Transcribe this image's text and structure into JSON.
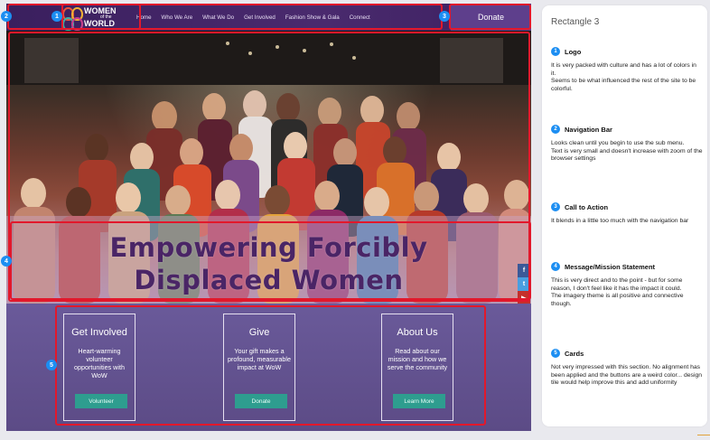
{
  "website": {
    "logo": {
      "line1": "WOMEN",
      "line2": "of the",
      "line3": "WORLD"
    },
    "nav_items": [
      "Home",
      "Who We Are",
      "What We Do",
      "Get Involved",
      "Fashion Show & Gala",
      "Connect"
    ],
    "donate_label": "Donate",
    "hero_headline_line1": "Empowering Forcibly",
    "hero_headline_line2": "Displaced Women",
    "social_icons": [
      "facebook-icon",
      "twitter-icon",
      "youtube-icon",
      "instagram-icon",
      "other-social-icon"
    ],
    "cards": [
      {
        "title": "Get Involved",
        "text": "Heart-warming volunteer opportunities with WoW",
        "button": "Volunteer"
      },
      {
        "title": "Give",
        "text": "Your gift makes a profound, measurable impact at WoW",
        "button": "Donate"
      },
      {
        "title": "About Us",
        "text": "Read about our mission and how we serve the community",
        "button": "Learn More"
      }
    ]
  },
  "annotations": {
    "badges": [
      "1",
      "2",
      "3",
      "4",
      "5"
    ]
  },
  "panel": {
    "title": "Rectangle 3",
    "notes": [
      {
        "num": "1",
        "heading": "Logo",
        "body": "It is very packed with culture and has a lot of colors in it.\nSeems to be what influenced the rest of the site to be colorful."
      },
      {
        "num": "2",
        "heading": "Navigation Bar",
        "body": "Looks clean until you begin to use the sub menu.\nText is very small and doesn't increase with zoom of the browser settings"
      },
      {
        "num": "3",
        "heading": "Call to Action",
        "body": "It blends in a little too much with the navigation bar"
      },
      {
        "num": "4",
        "heading": "Message/Mission Statement",
        "body": "This is very direct and to the point - but for some reason, I don't feel like it has the impact it could.\nThe imagery theme is all positive and connective though."
      },
      {
        "num": "5",
        "heading": "Cards",
        "body": "Not very impressed with this section. No alignment has been applied and the buttons are a weird color... design tile would help improve this and add uniformity"
      }
    ]
  },
  "colors": {
    "nav": "#3a1f5e",
    "donate": "#5e3f8c",
    "card_button": "#2e9d8f",
    "annotation_red": "#e2182b",
    "badge_blue": "#1c8ef2",
    "headline": "#4a2566"
  }
}
